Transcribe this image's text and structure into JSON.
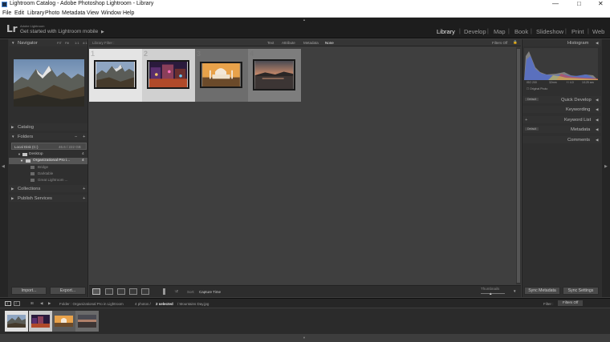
{
  "window": {
    "title": "Lightroom Catalog - Adobe Photoshop Lightroom - Library",
    "controls": {
      "minimize": "—",
      "maximize": "□",
      "close": "✕"
    }
  },
  "menu": [
    "File",
    "Edit",
    "Library",
    "Photo",
    "Metadata",
    "View",
    "Window",
    "Help"
  ],
  "identity": {
    "logo": "Lr",
    "small_text": "Adobe Lightroom",
    "main_text": "Get started with Lightroom mobile",
    "arrow": "▶"
  },
  "modules": [
    {
      "label": "Library",
      "active": true
    },
    {
      "label": "Develop",
      "active": false
    },
    {
      "label": "Map",
      "active": false
    },
    {
      "label": "Book",
      "active": false
    },
    {
      "label": "Slideshow",
      "active": false
    },
    {
      "label": "Print",
      "active": false
    },
    {
      "label": "Web",
      "active": false
    }
  ],
  "module_sep": "|",
  "left_panel": {
    "navigator": {
      "label": "Navigator",
      "zoom_options": [
        "FIT",
        "Fill",
        "1:1",
        "4:1"
      ]
    },
    "catalog": {
      "label": "Catalog"
    },
    "folders": {
      "label": "Folders",
      "plus": "+",
      "minus": "−",
      "volume": {
        "name": "Local Disk (C:)",
        "free": "46.6 / 222 GB"
      },
      "items": [
        {
          "name": "Desktop",
          "count": "4"
        },
        {
          "name": "Organizational Pro i...",
          "count": "4"
        }
      ],
      "subfolders": [
        "Bridge",
        "Darktable",
        "Great Lightroom ..."
      ]
    },
    "collections": {
      "label": "Collections",
      "plus": "+"
    },
    "publish": {
      "label": "Publish Services",
      "plus": "+"
    },
    "import_btn": "Import...",
    "export_btn": "Export..."
  },
  "library_filter": {
    "label": "Library Filter :",
    "options": [
      "Text",
      "Attribute",
      "Metadata",
      "None"
    ],
    "active": "None",
    "filters_off": "Filters Off"
  },
  "grid": {
    "cells": [
      {
        "num": "1",
        "photo": "mountains",
        "selected": true
      },
      {
        "num": "2",
        "photo": "city-night",
        "selected": true
      },
      {
        "num": "3",
        "photo": "taj-mahal",
        "selected": false
      },
      {
        "num": "4",
        "photo": "sunset-lake",
        "selected": false
      }
    ]
  },
  "toolbar": {
    "sort_label": "Sort:",
    "sort_value": "Capture Time",
    "thumbnails_label": "Thumbnails"
  },
  "right_panel": {
    "histogram": {
      "label": "Histogram",
      "info": [
        "ISO 200",
        "32mm",
        "f / 4.0",
        "1/125 sec"
      ],
      "original_photo": "Original Photo"
    },
    "sections": [
      {
        "label": "Quick Develop",
        "dropdown": "Default"
      },
      {
        "label": "Keywording",
        "dropdown": ""
      },
      {
        "label": "Keyword List",
        "dropdown": ""
      },
      {
        "label": "Metadata",
        "dropdown": "Default"
      },
      {
        "label": "Comments",
        "dropdown": ""
      }
    ],
    "sync_metadata": "Sync Metadata",
    "sync_settings": "Sync Settings"
  },
  "filmstrip_bar": {
    "page1": "1",
    "page2": "2",
    "path": "Folder : Organizational Pro in Lightroom",
    "count": "4 photos /",
    "selected": "2 selected",
    "file": "/ Mountains Day.jpg",
    "filter_label": "Filter :",
    "filter_value": "Filters Off"
  },
  "colors": {
    "accent": "#d9d9d9",
    "panel": "#2f2f2f",
    "background": "#3d3d3d",
    "dark": "#1d1d1d"
  }
}
